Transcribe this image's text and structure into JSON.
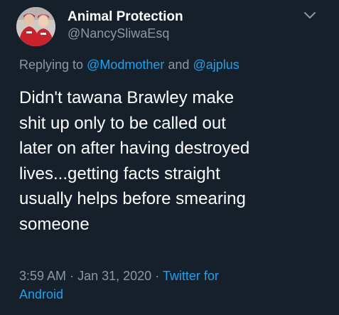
{
  "tweet": {
    "display_name": "Animal Protection",
    "handle": "@NancySliwaEsq",
    "reply": {
      "prefix": "Replying to",
      "mention1": "@Modmother",
      "conjunction": "and",
      "mention2": "@ajplus"
    },
    "text_lines": [
      "Didn't tawana Brawley make",
      "shit up only to be called out",
      "later on after having destroyed",
      "lives...getting facts straight",
      "usually helps before smearing",
      "someone"
    ],
    "time": "3:59 AM",
    "separator": "·",
    "date": "Jan 31, 2020",
    "source_line1": "Twitter for",
    "source_line2": "Android"
  },
  "icons": {
    "menu": "chevron-down-icon",
    "avatar": "avatar"
  },
  "colors": {
    "background": "#15202b",
    "primary_text": "#ffffff",
    "secondary_text": "#8899a6",
    "link": "#1da1f2"
  }
}
